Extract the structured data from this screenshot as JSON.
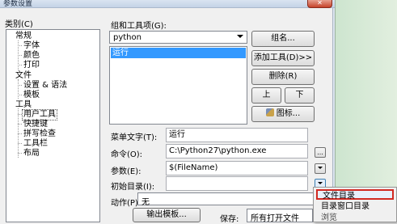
{
  "window": {
    "title": "参数设置",
    "close_glyph": "✕"
  },
  "categories": {
    "label": "类别(C)",
    "tree": [
      {
        "text": "常规"
      },
      {
        "text": "字体"
      },
      {
        "text": "颜色"
      },
      {
        "text": "打印"
      },
      {
        "text": "文件"
      },
      {
        "text": "设置 & 语法"
      },
      {
        "text": "模板"
      },
      {
        "text": "工具"
      },
      {
        "text": "用户工具"
      },
      {
        "text": "快捷键"
      },
      {
        "text": "拼写检查"
      },
      {
        "text": "工具栏"
      },
      {
        "text": "布局"
      }
    ]
  },
  "tools": {
    "group_label": "组和工具项(G):",
    "group_value": "python",
    "list_items": [
      "运行"
    ],
    "buttons": {
      "group": "组名...",
      "add_tool": "添加工具(D)>>",
      "delete": "删除(R)",
      "up": "上",
      "down": "下",
      "icon": "图标..."
    }
  },
  "form": {
    "menu_text_label": "菜单文字(T):",
    "menu_text_value": "运行",
    "command_label": "命令(O):",
    "command_value": "C:\\Python27\\python.exe",
    "browse_label": "...",
    "params_label": "参数(E):",
    "params_value": "$(FileName)",
    "initdir_label": "初始目录(I):",
    "initdir_value": "",
    "action_label": "动作(P):",
    "action_value": "无",
    "output_template_label": "输出模板...",
    "save_label": "保存:",
    "save_value": "所有打开文件"
  },
  "dropdown_menu": [
    "文件目录",
    "目录窗口目录",
    "浏览"
  ]
}
